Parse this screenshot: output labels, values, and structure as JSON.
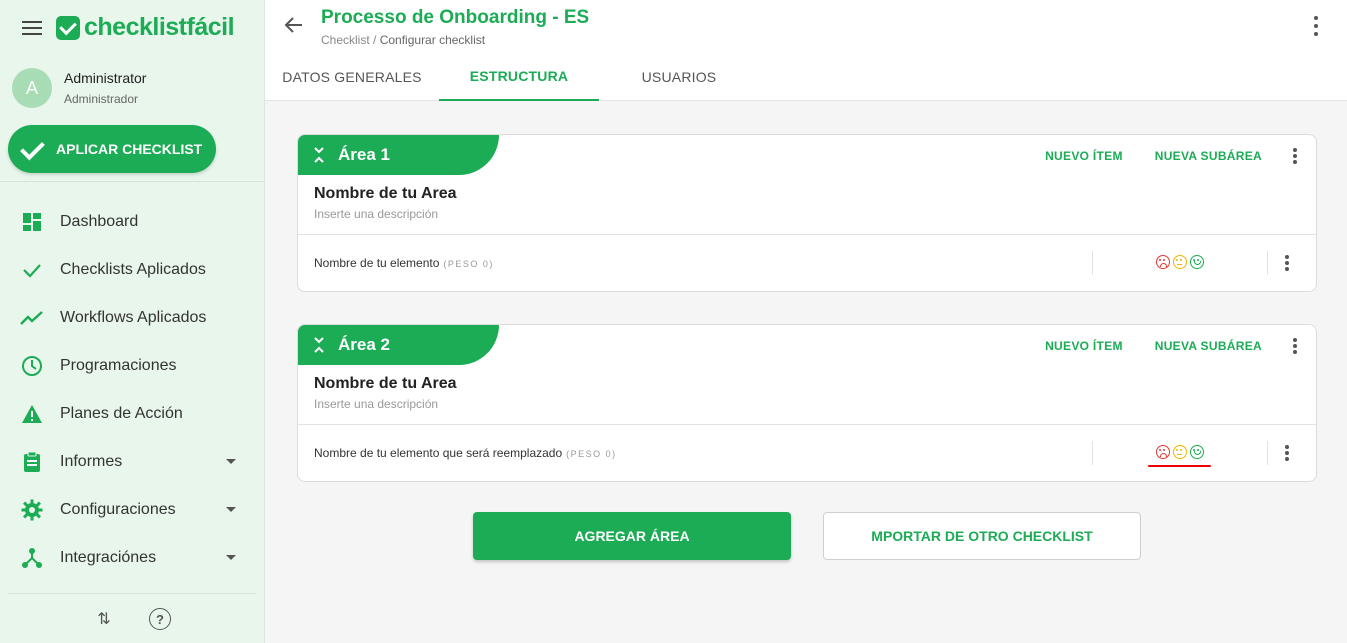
{
  "brand": {
    "logo_text": "checklistfácil"
  },
  "user": {
    "initial": "A",
    "name": "Administrator",
    "role": "Administrador"
  },
  "sidebar": {
    "apply_label": "APLICAR CHECKLIST",
    "items": [
      {
        "label": "Dashboard",
        "icon": "dashboard-icon"
      },
      {
        "label": "Checklists Aplicados",
        "icon": "check-icon"
      },
      {
        "label": "Workflows Aplicados",
        "icon": "trend-icon"
      },
      {
        "label": "Programaciones",
        "icon": "clock-icon"
      },
      {
        "label": "Planes de Acción",
        "icon": "warning-icon"
      },
      {
        "label": "Informes",
        "icon": "clipboard-icon",
        "expandable": true
      },
      {
        "label": "Configuraciones",
        "icon": "gear-icon",
        "expandable": true
      },
      {
        "label": "Integraciónes",
        "icon": "hub-icon",
        "expandable": true
      }
    ],
    "footer_icons": [
      "sort-icon",
      "help-icon"
    ],
    "footer_help_glyph": "?",
    "footer_sort_glyph": "⇅"
  },
  "header": {
    "title": "Processo de Onboarding - ES",
    "breadcrumb_root": "Checklist /",
    "breadcrumb_current": "Configurar checklist"
  },
  "tabs": [
    {
      "label": "DATOS GENERALES",
      "active": false
    },
    {
      "label": "ESTRUCTURA",
      "active": true
    },
    {
      "label": "USUARIOS",
      "active": false
    }
  ],
  "areas": [
    {
      "title": "Área 1",
      "new_item": "NUEVO ÍTEM",
      "new_subarea": "NUEVA SUBÁREA",
      "name": "Nombre de tu Area",
      "description": "Inserte una descripción",
      "item_name": "Nombre de tu elemento",
      "item_weight": "(PESO 0)"
    },
    {
      "title": "Área 2",
      "new_item": "NUEVO ÍTEM",
      "new_subarea": "NUEVA SUBÁREA",
      "name": "Nombre de tu Area",
      "description": "Inserte una descripción",
      "item_name": "Nombre de tu elemento que será reemplazado",
      "item_weight": "(PESO 0)"
    }
  ],
  "actions": {
    "add_area": "AGREGAR ÁREA",
    "import": "MPORTAR DE OTRO CHECKLIST"
  },
  "colors": {
    "accent": "#1bac55",
    "sidebar_bg": "#e8f6ec",
    "bad": "#e53935",
    "mid": "#f2b500",
    "highlight": "#e00000"
  }
}
